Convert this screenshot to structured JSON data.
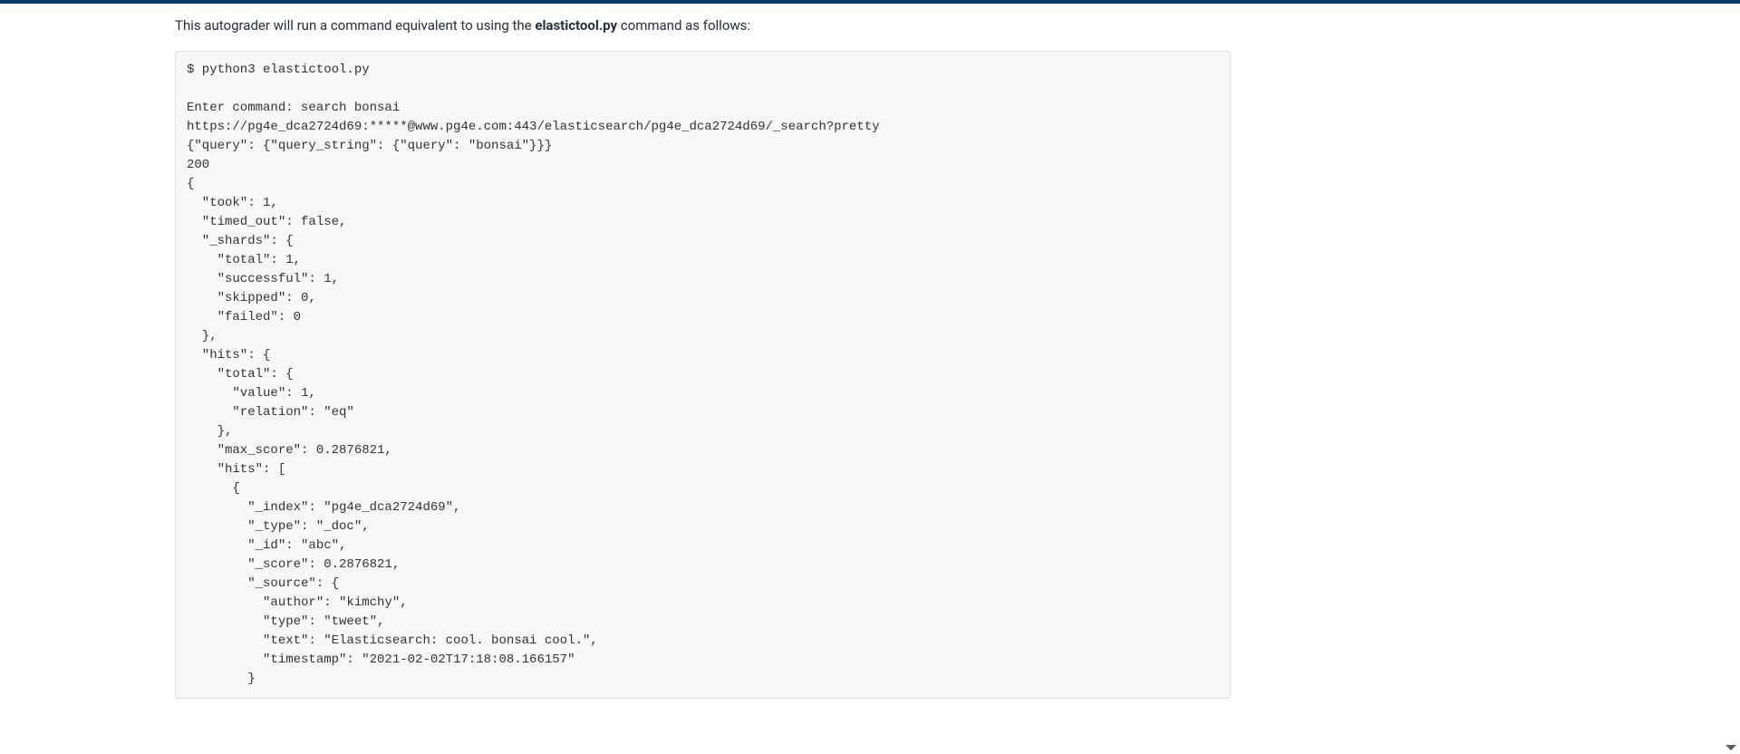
{
  "intro": {
    "prefix": "This autograder will run a command equivalent to using the ",
    "bold": "elastictool.py",
    "suffix": " command as follows:"
  },
  "code": "$ python3 elastictool.py\n\nEnter command: search bonsai\nhttps://pg4e_dca2724d69:*****@www.pg4e.com:443/elasticsearch/pg4e_dca2724d69/_search?pretty\n{\"query\": {\"query_string\": {\"query\": \"bonsai\"}}}\n200\n{\n  \"took\": 1,\n  \"timed_out\": false,\n  \"_shards\": {\n    \"total\": 1,\n    \"successful\": 1,\n    \"skipped\": 0,\n    \"failed\": 0\n  },\n  \"hits\": {\n    \"total\": {\n      \"value\": 1,\n      \"relation\": \"eq\"\n    },\n    \"max_score\": 0.2876821,\n    \"hits\": [\n      {\n        \"_index\": \"pg4e_dca2724d69\",\n        \"_type\": \"_doc\",\n        \"_id\": \"abc\",\n        \"_score\": 0.2876821,\n        \"_source\": {\n          \"author\": \"kimchy\",\n          \"type\": \"tweet\",\n          \"text\": \"Elasticsearch: cool. bonsai cool.\",\n          \"timestamp\": \"2021-02-02T17:18:08.166157\"\n        }"
}
